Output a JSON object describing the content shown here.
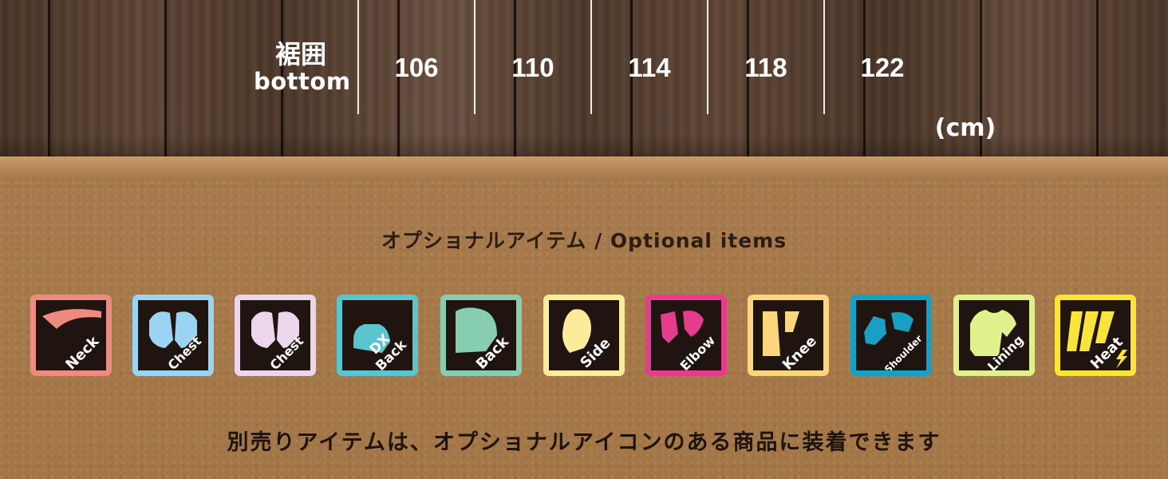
{
  "size_table": {
    "row_label_jp": "裾囲",
    "row_label_en": "bottom",
    "values": [
      "106",
      "110",
      "114",
      "118",
      "122"
    ],
    "unit": "(cm)"
  },
  "optional_items": {
    "title": "オプショナルアイテム / Optional items",
    "icons": [
      {
        "label": "Neck",
        "color": "#ef8a80",
        "icon": "neck-icon"
      },
      {
        "label": "Chest",
        "color": "#9dd3f2",
        "icon": "chest-icon"
      },
      {
        "label": "Chest",
        "color": "#ecd6ec",
        "icon": "chest-icon"
      },
      {
        "label": "DX",
        "label2": "Back",
        "color": "#5bc5cf",
        "icon": "dx-back-icon"
      },
      {
        "label": "Back",
        "color": "#86cdb2",
        "icon": "back-icon"
      },
      {
        "label": "Side",
        "color": "#fbeb9a",
        "icon": "side-icon"
      },
      {
        "label": "Elbow",
        "color": "#e63c8e",
        "icon": "elbow-icon"
      },
      {
        "label": "Knee",
        "color": "#fcd57c",
        "icon": "knee-icon"
      },
      {
        "label": "Shoulder",
        "color": "#1a9fc4",
        "icon": "shoulder-icon"
      },
      {
        "label": "Lining",
        "color": "#dff08c",
        "icon": "lining-icon"
      },
      {
        "label": "Heat",
        "color": "#fbe43a",
        "icon": "heat-icon"
      }
    ],
    "note": "別売りアイテムは、オプショナルアイコンのある商品に装着できます"
  }
}
